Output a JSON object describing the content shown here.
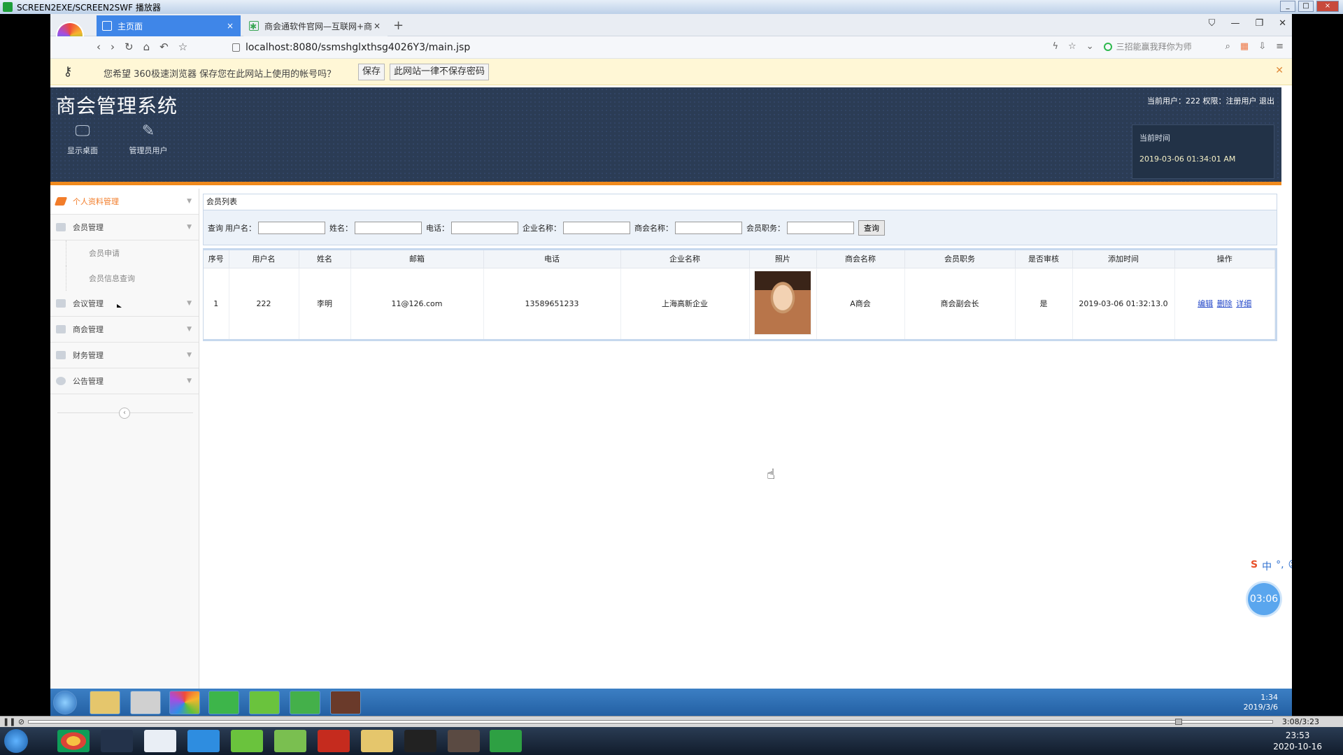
{
  "player": {
    "title": "SCREEN2EXE/SCREEN2SWF 播放器"
  },
  "browser": {
    "tabs": [
      {
        "label": "主页面"
      },
      {
        "label": "商会通软件官网—互联网+商会"
      }
    ],
    "url": "localhost:8080/ssmshglxthsg4026Y3/main.jsp",
    "search_hint": "三招能赢我拜你为师"
  },
  "password_bar": {
    "message": "您希望 360极速浏览器 保存您在此网站上使用的帐号吗？",
    "save_label": "保存",
    "never_label": "此网站一律不保存密码"
  },
  "app": {
    "title": "商会管理系统",
    "user_info": "当前用户：222 权限：注册用户 退出",
    "toolbar": [
      {
        "label": "显示桌面",
        "icon": "monitor-icon"
      },
      {
        "label": "管理员用户",
        "icon": "pencil-icon"
      }
    ],
    "clock": {
      "label": "当前时间",
      "value": "2019-03-06 01:34:01 AM"
    }
  },
  "sidebar": {
    "menus": [
      {
        "label": "个人资料管理",
        "active": true
      },
      {
        "label": "会员管理"
      },
      {
        "label": "会议管理"
      },
      {
        "label": "商会管理"
      },
      {
        "label": "财务管理"
      },
      {
        "label": "公告管理"
      }
    ],
    "sub_items": [
      {
        "label": "会员申请"
      },
      {
        "label": "会员信息查询"
      }
    ]
  },
  "panel": {
    "title": "会员列表",
    "search": {
      "prefix": "查询",
      "fields": [
        {
          "label": "用户名：",
          "value": ""
        },
        {
          "label": "姓名：",
          "value": ""
        },
        {
          "label": "电话：",
          "value": ""
        },
        {
          "label": "企业名称：",
          "value": ""
        },
        {
          "label": "商会名称：",
          "value": ""
        },
        {
          "label": "会员职务：",
          "value": ""
        }
      ],
      "button": "查询"
    },
    "table": {
      "headers": [
        "序号",
        "用户名",
        "姓名",
        "邮箱",
        "电话",
        "企业名称",
        "照片",
        "商会名称",
        "会员职务",
        "是否审核",
        "添加时间",
        "操作"
      ],
      "rows": [
        {
          "no": "1",
          "username": "222",
          "name": "李明",
          "email": "11@126.com",
          "phone": "13589651233",
          "company": "上海高新企业",
          "chamber": "A商会",
          "position": "商会副会长",
          "approved": "是",
          "time": "2019-03-06 01:32:13.0",
          "actions": [
            "编辑",
            "删除",
            "详细"
          ]
        }
      ]
    }
  },
  "overlay": {
    "timer": "03:06"
  },
  "player_controls": {
    "time": "3:08/3:23"
  },
  "inner_tray": {
    "time": "1:34",
    "date": "2019/3/6"
  },
  "taskbar": {
    "time": "23:53",
    "date": "2020-10-16"
  },
  "colors": {
    "accent": "#f08a1d",
    "header_bg": "#2b3c55",
    "tab_active": "#3f86e8",
    "link": "#2347c8"
  }
}
